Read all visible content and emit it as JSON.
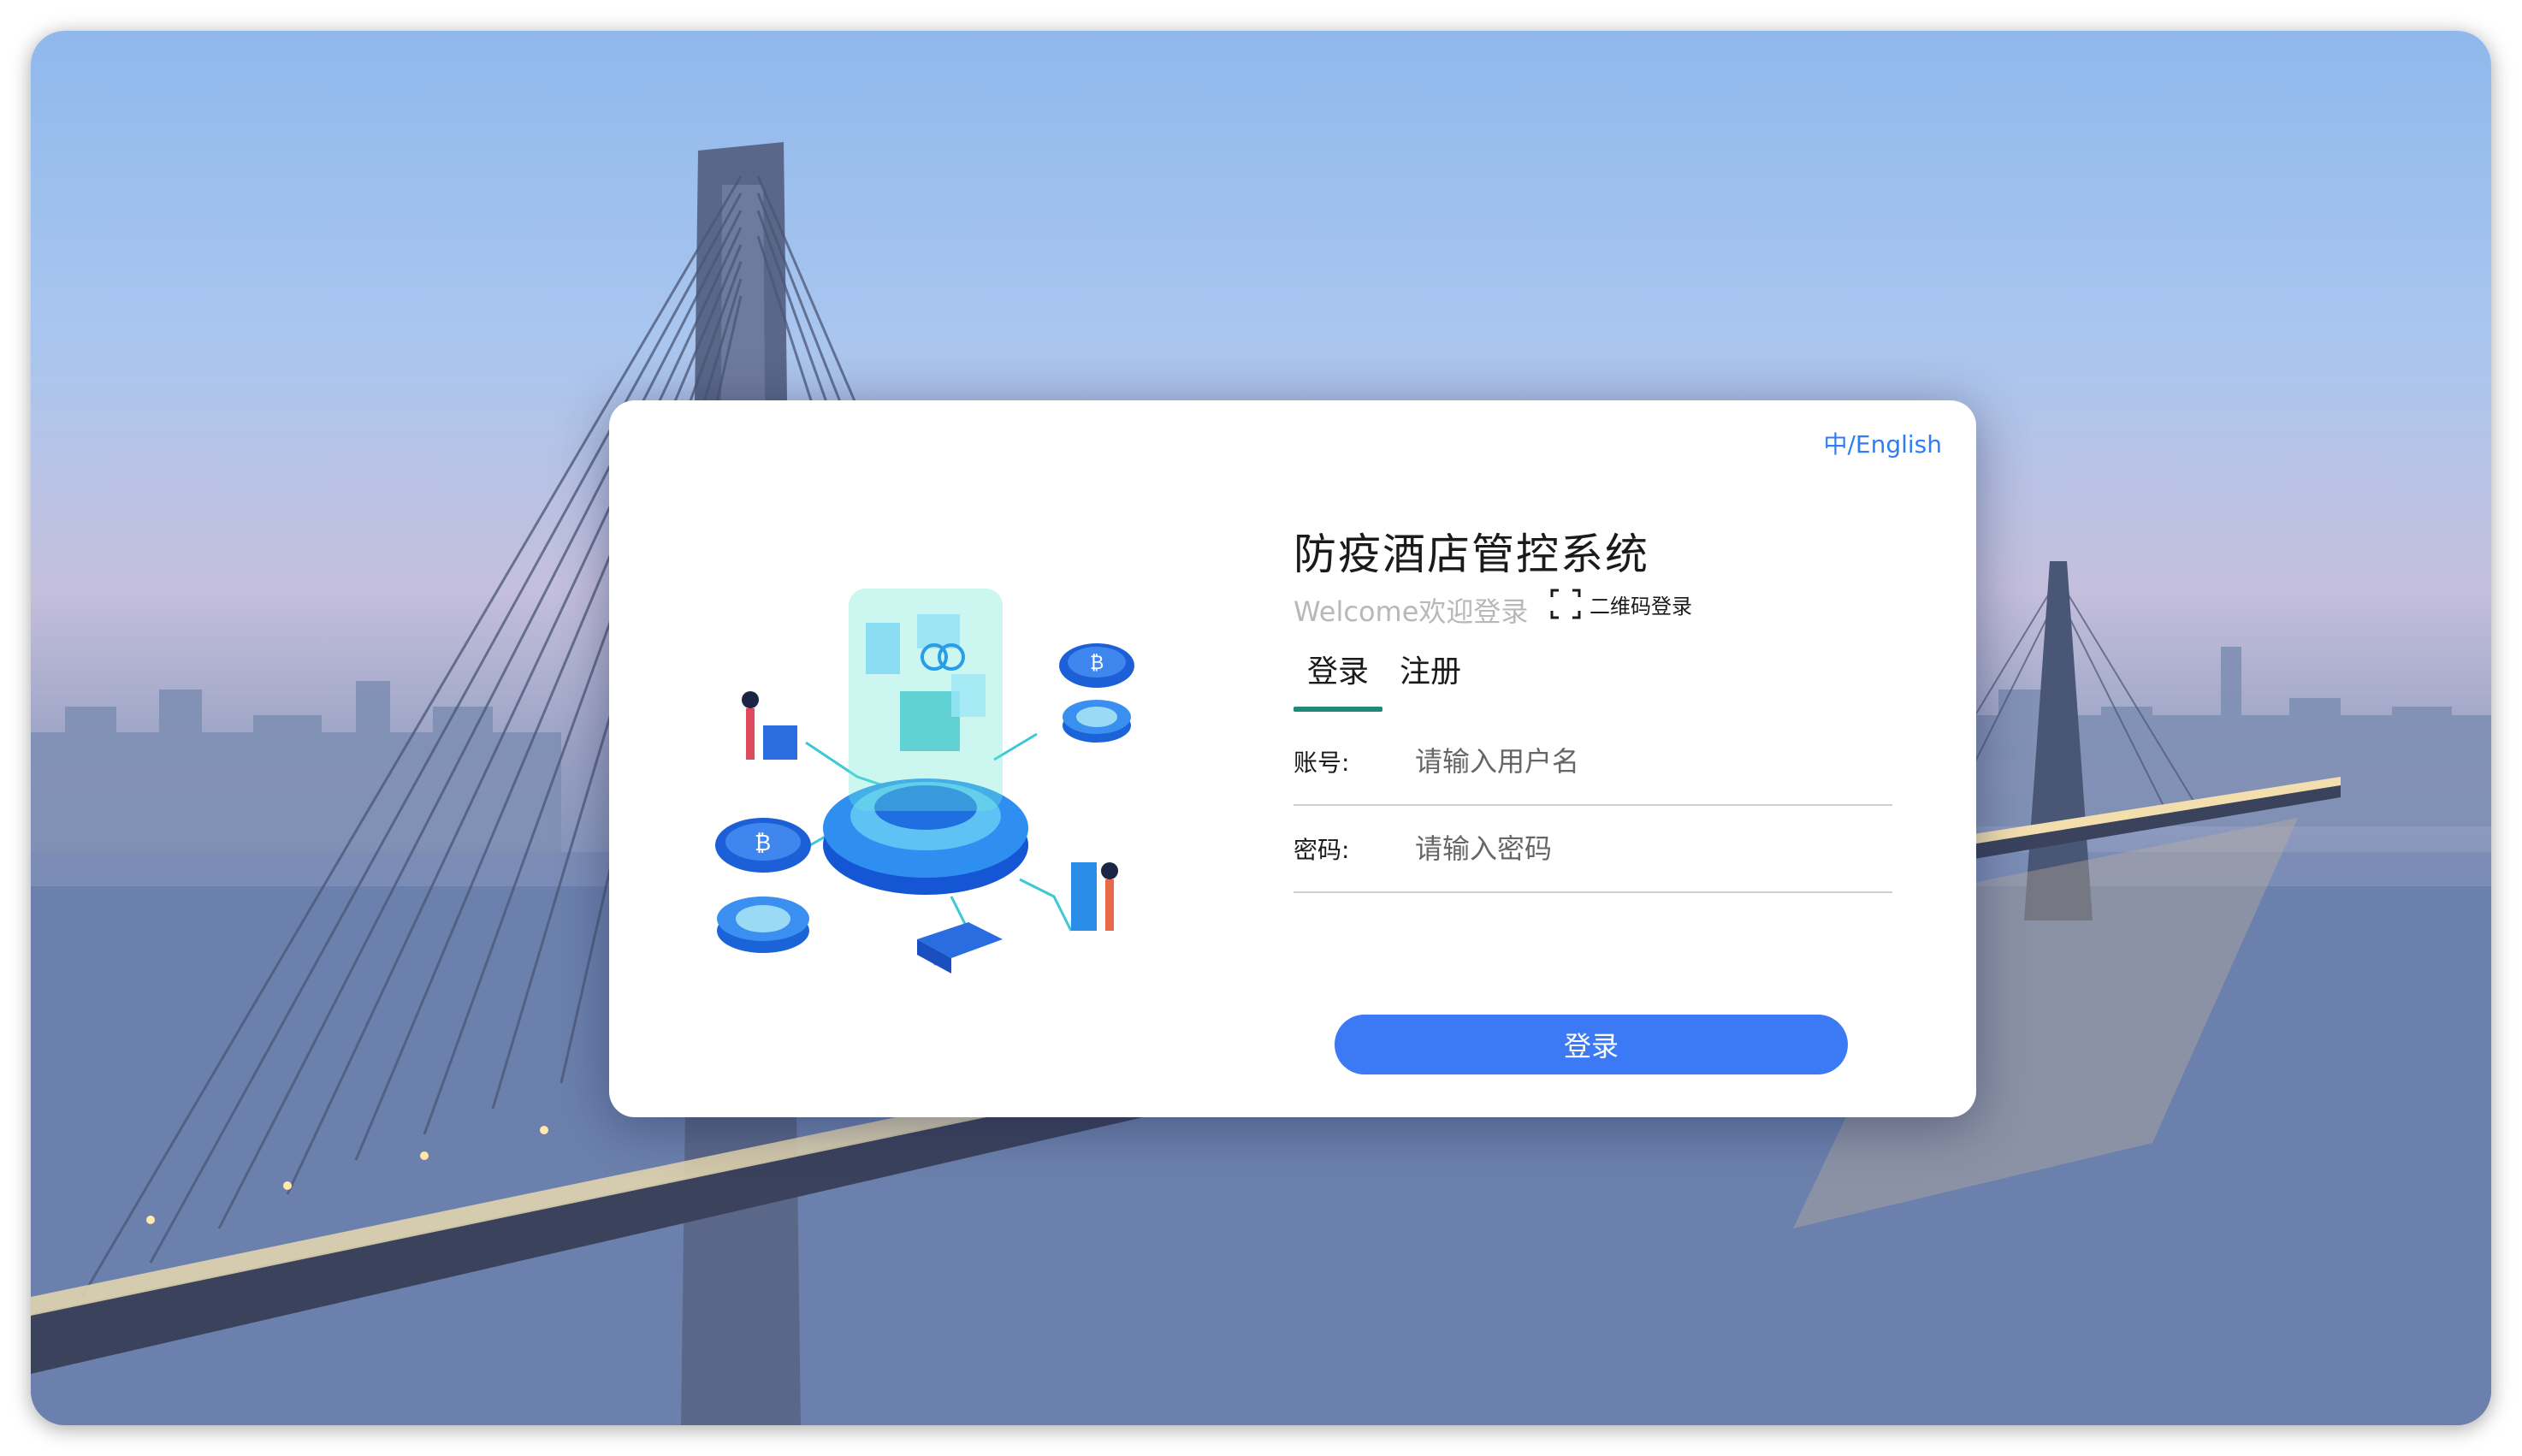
{
  "lang_switch": {
    "zh": "中",
    "sep": "/",
    "en": "English"
  },
  "title": "防疫酒店管控系统",
  "welcome": "Welcome欢迎登录",
  "qr_login": {
    "label": "二维码登录",
    "icon": "scan-icon"
  },
  "tabs": [
    {
      "label": "登录",
      "active": true
    },
    {
      "label": "注册",
      "active": false
    }
  ],
  "form": {
    "account": {
      "label": "账号:",
      "placeholder": "请输入用户名"
    },
    "password": {
      "label": "密码:",
      "placeholder": "请输入密码"
    }
  },
  "submit_label": "登录",
  "colors": {
    "accent": "#3c79f4",
    "tab_underline": "#1f8a76",
    "link": "#2f7df6"
  }
}
